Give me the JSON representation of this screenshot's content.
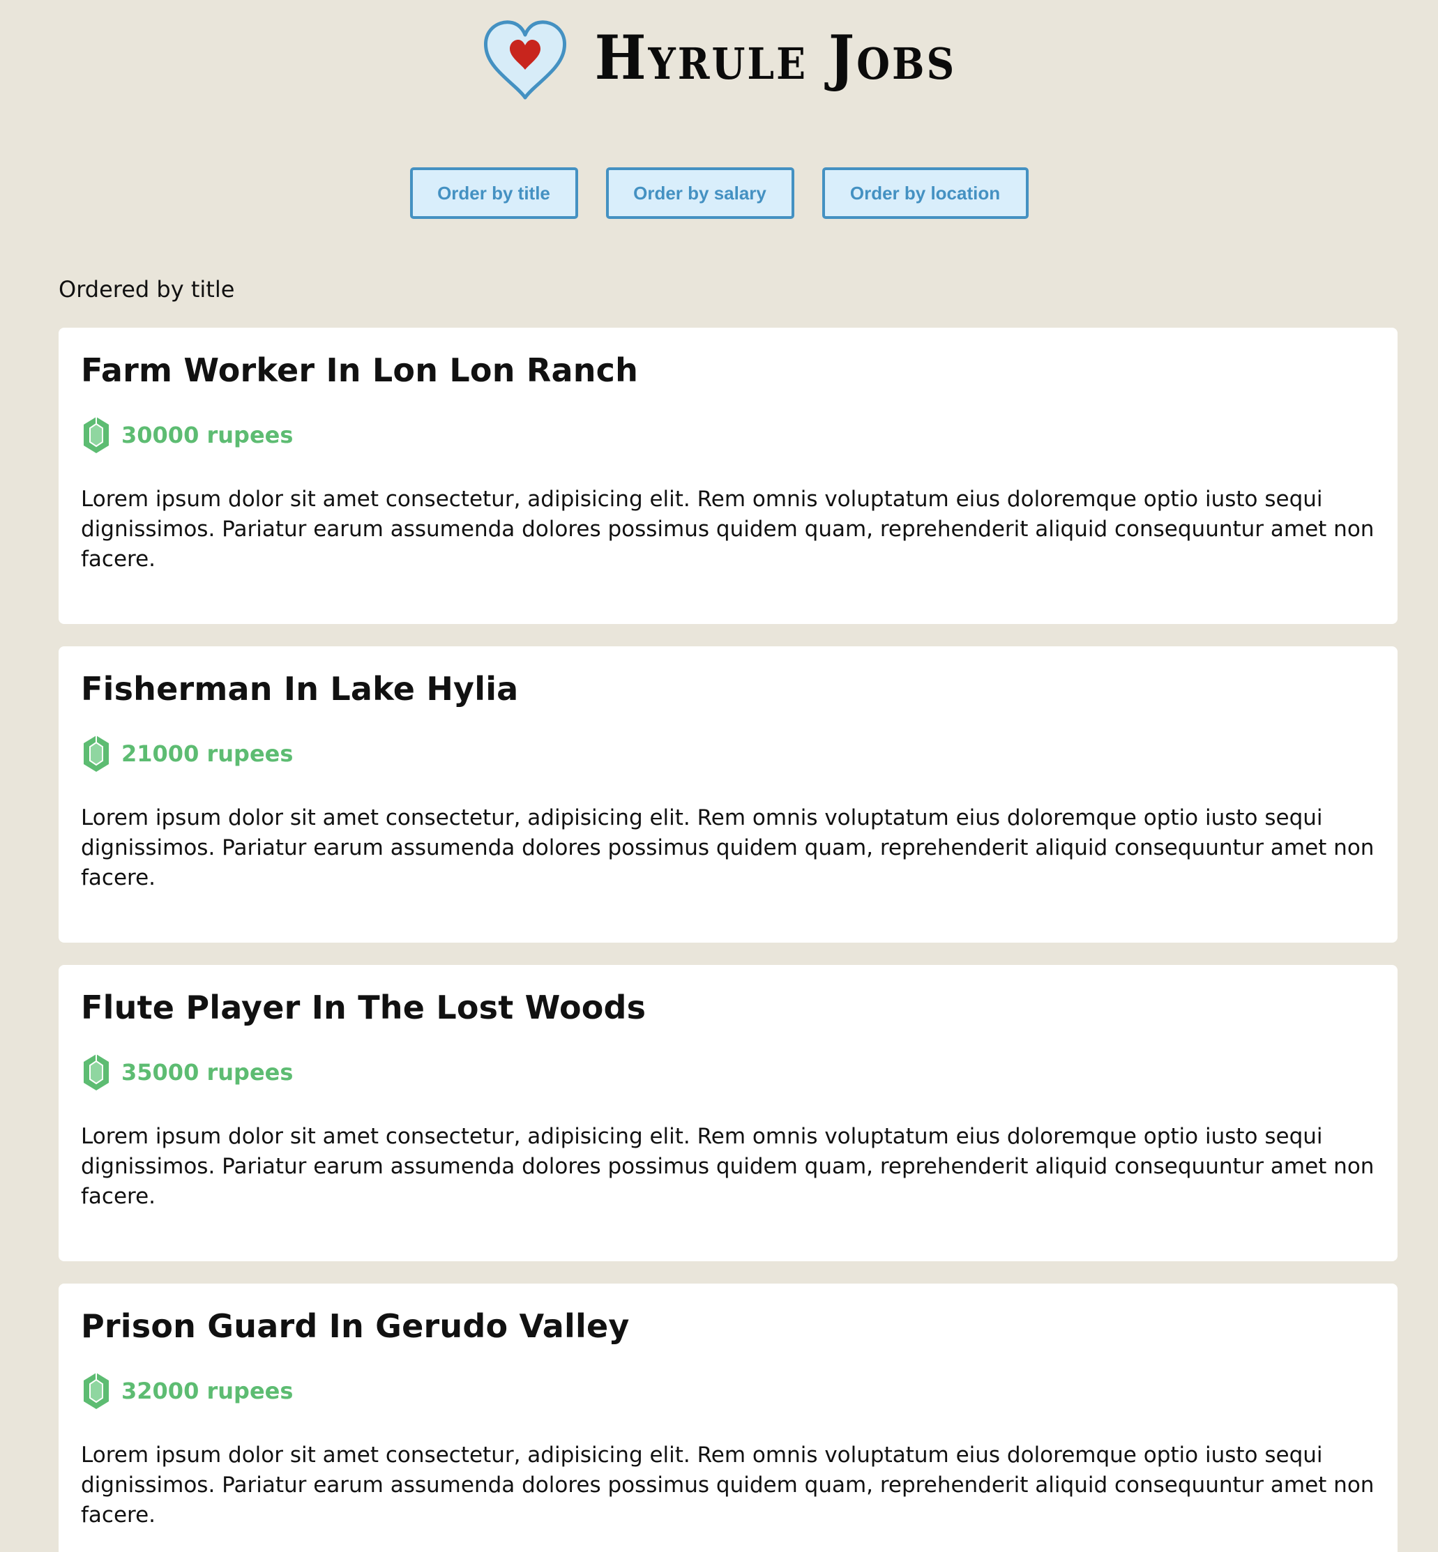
{
  "header": {
    "logo_text": "Hyrule Jobs",
    "logo_icon": "heart-container-icon"
  },
  "order_buttons": {
    "title": "Order by title",
    "salary": "Order by salary",
    "location": "Order by location"
  },
  "ordered_label": "Ordered by title",
  "colors": {
    "background": "#e9e5da",
    "button_border": "#4491c2",
    "button_fill": "#d9eefb",
    "salary_green": "#5dbc72",
    "heart_red": "#c8251d",
    "heart_outline": "#4491c2"
  },
  "jobs": [
    {
      "title": "Farm Worker In Lon Lon Ranch",
      "salary": "30000 rupees",
      "icon": "rupee-icon",
      "description": "Lorem ipsum dolor sit amet consectetur, adipisicing elit. Rem omnis voluptatum eius doloremque optio iusto sequi dignissimos. Pariatur earum assumenda dolores possimus quidem quam, reprehenderit aliquid consequuntur amet non facere."
    },
    {
      "title": "Fisherman In Lake Hylia",
      "salary": "21000 rupees",
      "icon": "rupee-icon",
      "description": "Lorem ipsum dolor sit amet consectetur, adipisicing elit. Rem omnis voluptatum eius doloremque optio iusto sequi dignissimos. Pariatur earum assumenda dolores possimus quidem quam, reprehenderit aliquid consequuntur amet non facere."
    },
    {
      "title": "Flute Player In The Lost Woods",
      "salary": "35000 rupees",
      "icon": "rupee-icon",
      "description": "Lorem ipsum dolor sit amet consectetur, adipisicing elit. Rem omnis voluptatum eius doloremque optio iusto sequi dignissimos. Pariatur earum assumenda dolores possimus quidem quam, reprehenderit aliquid consequuntur amet non facere."
    },
    {
      "title": "Prison Guard In Gerudo Valley",
      "salary": "32000 rupees",
      "icon": "rupee-icon",
      "description": "Lorem ipsum dolor sit amet consectetur, adipisicing elit. Rem omnis voluptatum eius doloremque optio iusto sequi dignissimos. Pariatur earum assumenda dolores possimus quidem quam, reprehenderit aliquid consequuntur amet non facere."
    }
  ]
}
